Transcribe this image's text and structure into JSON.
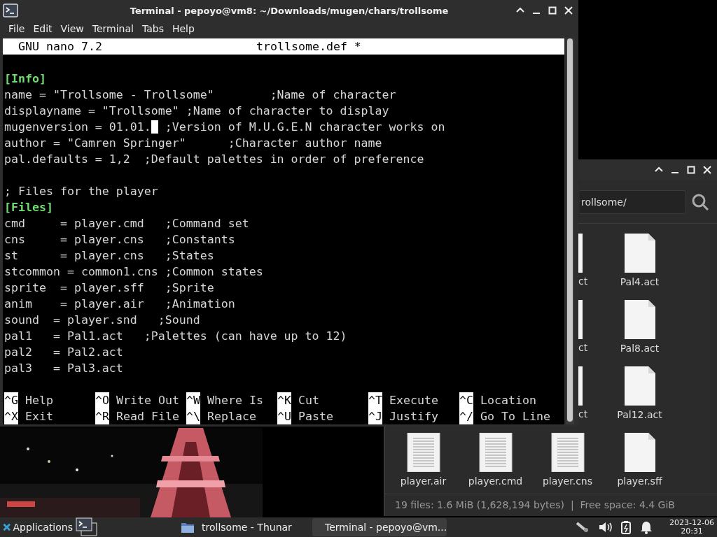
{
  "terminal_window": {
    "title": "Terminal - pepoyo@vm8: ~/Downloads/mugen/chars/trollsome",
    "menu": [
      "File",
      "Edit",
      "View",
      "Terminal",
      "Tabs",
      "Help"
    ],
    "nano": {
      "version": "GNU nano 7.2",
      "file": "trollsome.def *",
      "lines": [
        {
          "kind": "blank"
        },
        {
          "kind": "section",
          "text": "[Info]"
        },
        {
          "kind": "code",
          "text": "name = \"Trollsome - Trollsome\"        ;Name of character"
        },
        {
          "kind": "code",
          "text": "displayname = \"Trollsome\" ;Name of character to display"
        },
        {
          "kind": "cursor",
          "before": "mugenversion = 01.01.",
          "after": " ;Version of M.U.G.E.N character works on"
        },
        {
          "kind": "code",
          "text": "author = \"Camren Springer\"      ;Character author name"
        },
        {
          "kind": "code",
          "text": "pal.defaults = 1,2  ;Default palettes in order of preference"
        },
        {
          "kind": "blank"
        },
        {
          "kind": "code",
          "text": "; Files for the player"
        },
        {
          "kind": "section",
          "text": "[Files]"
        },
        {
          "kind": "code",
          "text": "cmd     = player.cmd   ;Command set"
        },
        {
          "kind": "code",
          "text": "cns     = player.cns   ;Constants"
        },
        {
          "kind": "code",
          "text": "st      = player.cns   ;States"
        },
        {
          "kind": "code",
          "text": "stcommon = common1.cns ;Common states"
        },
        {
          "kind": "code",
          "text": "sprite  = player.sff   ;Sprite"
        },
        {
          "kind": "code",
          "text": "anim    = player.air   ;Animation"
        },
        {
          "kind": "code",
          "text": "sound  = player.snd   ;Sound"
        },
        {
          "kind": "code",
          "text": "pal1   = Pal1.act   ;Palettes (can have up to 12)"
        },
        {
          "kind": "code",
          "text": "pal2   = Pal2.act"
        },
        {
          "kind": "code",
          "text": "pal3   = Pal3.act"
        },
        {
          "kind": "blank"
        }
      ],
      "shortcuts": [
        {
          "key": "^G",
          "label": "Help"
        },
        {
          "key": "^O",
          "label": "Write Out"
        },
        {
          "key": "^W",
          "label": "Where Is"
        },
        {
          "key": "^K",
          "label": "Cut"
        },
        {
          "key": "^T",
          "label": "Execute"
        },
        {
          "key": "^C",
          "label": "Location"
        },
        {
          "key": "^X",
          "label": "Exit"
        },
        {
          "key": "^R",
          "label": "Read File"
        },
        {
          "key": "^\\",
          "label": "Replace"
        },
        {
          "key": "^U",
          "label": "Paste"
        },
        {
          "key": "^J",
          "label": "Justify"
        },
        {
          "key": "^/",
          "label": "Go To Line"
        }
      ]
    }
  },
  "file_manager": {
    "location": "rollsome/",
    "files": [
      {
        "kind": "hidden"
      },
      {
        "kind": "hidden"
      },
      {
        "kind": "partial",
        "label": "ct"
      },
      {
        "kind": "blank",
        "label": "Pal4.act"
      },
      {
        "kind": "hidden"
      },
      {
        "kind": "hidden"
      },
      {
        "kind": "partial",
        "label": "ct"
      },
      {
        "kind": "blank",
        "label": "Pal8.act"
      },
      {
        "kind": "hidden"
      },
      {
        "kind": "hidden"
      },
      {
        "kind": "partial",
        "label": "ct"
      },
      {
        "kind": "blank",
        "label": "Pal12.act"
      },
      {
        "kind": "text",
        "label": "player.air"
      },
      {
        "kind": "text",
        "label": "player.cmd"
      },
      {
        "kind": "text",
        "label": "player.cns"
      },
      {
        "kind": "blank",
        "label": "player.sff"
      }
    ],
    "status": "19 files: 1.6 MiB (1,628,194 bytes)  |  Free space: 4.4 GiB"
  },
  "taskbar": {
    "applications": "Applications",
    "tasks": [
      {
        "kind": "folder",
        "label": "trollsome - Thunar",
        "selected": false
      },
      {
        "kind": "terminal",
        "label": "Terminal - pepoyo@vm...",
        "selected": true
      }
    ],
    "date": "2023-12-06",
    "time": "20:31"
  }
}
